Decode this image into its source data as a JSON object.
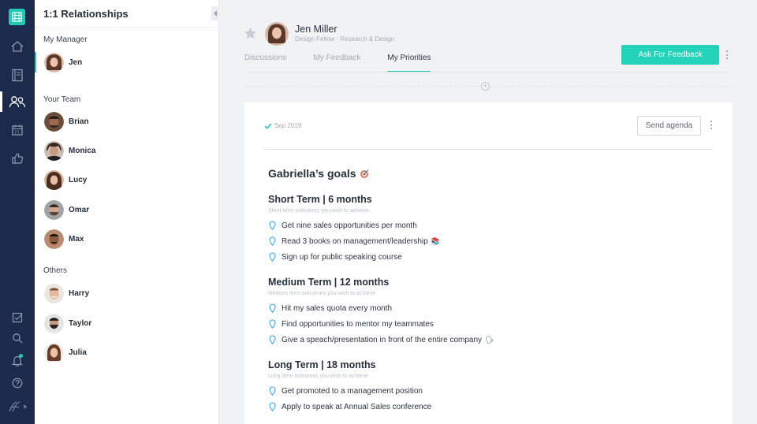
{
  "rail": {
    "items": [
      {
        "icon": "home-icon"
      },
      {
        "icon": "notebook-icon"
      },
      {
        "icon": "people-icon",
        "active": true
      },
      {
        "icon": "calendar-icon"
      },
      {
        "icon": "thumbs-up-icon"
      }
    ],
    "bottom_items": [
      {
        "icon": "checkbox-icon"
      },
      {
        "icon": "search-icon"
      },
      {
        "icon": "bell-icon"
      },
      {
        "icon": "help-icon"
      },
      {
        "icon": "brand-icon"
      }
    ],
    "accent_color": "#22c9b5",
    "background": "#1c2b4b"
  },
  "sidebar": {
    "title": "1:1 Relationships",
    "sections": [
      {
        "label": "My Manager",
        "people": [
          {
            "name": "Jen",
            "selected": true
          }
        ]
      },
      {
        "label": "Your Team",
        "people": [
          {
            "name": "Brian"
          },
          {
            "name": "Monica"
          },
          {
            "name": "Lucy"
          },
          {
            "name": "Omar"
          },
          {
            "name": "Max"
          }
        ]
      },
      {
        "label": "Others",
        "people": [
          {
            "name": "Harry"
          },
          {
            "name": "Taylor"
          },
          {
            "name": "Julia"
          }
        ]
      }
    ]
  },
  "header": {
    "name": "Jen Miller",
    "subtitle": "Design Fellow · Research & Design",
    "tabs": [
      {
        "label": "Discussions"
      },
      {
        "label": "My Feedback"
      },
      {
        "label": "My Priorities",
        "active": true
      }
    ],
    "feedback_button": "Ask For Feedback"
  },
  "card": {
    "date": "Sep 2019",
    "send_button": "Send agenda",
    "title": "Gabriella’s goals",
    "sections": [
      {
        "title": "Short Term | 6 months",
        "subtitle": "Short term outcomes you wish to achieve",
        "goals": [
          {
            "text": "Get nine sales opportunities per month"
          },
          {
            "text": "Read 3 books on management/leadership",
            "emoji": "📚"
          },
          {
            "text": "Sign up for public speaking course"
          }
        ]
      },
      {
        "title": "Medium Term | 12 months",
        "subtitle": "Medium term outcomes you wish to achieve",
        "goals": [
          {
            "text": "Hit my sales quota every month"
          },
          {
            "text": "Find opportunities to mentor my teammates"
          },
          {
            "text": "Give a speach/presentation in front of the entire company",
            "emoji": "🗣"
          }
        ]
      },
      {
        "title": "Long Term | 18 months",
        "subtitle": "Long term outcomes you wish to achieve",
        "goals": [
          {
            "text": "Get promoted to a management position"
          },
          {
            "text": "Apply to speak at Annual Sales conference"
          }
        ]
      }
    ]
  }
}
